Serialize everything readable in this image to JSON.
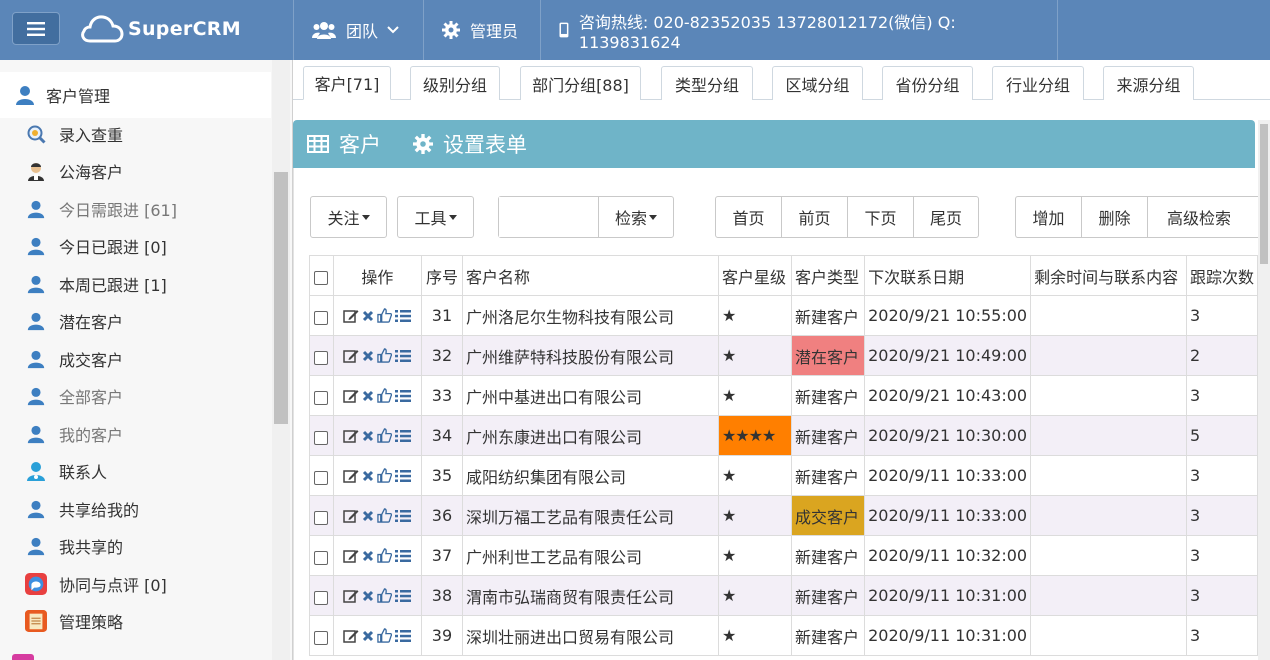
{
  "header": {
    "logo_text": "SuperCRM",
    "team_label": "团队",
    "admin_label": "管理员",
    "hotline": "咨询热线: 020-82352035 13728012172(微信) Q: 1139831624"
  },
  "sidebar": {
    "section_title": "客户管理",
    "items": [
      {
        "label": "录入查重",
        "icon": "search-magnifier-icon"
      },
      {
        "label": "公海客户",
        "icon": "agent-icon"
      },
      {
        "label": "今日需跟进 [61]",
        "icon": "user-icon"
      },
      {
        "label": "今日已跟进 [0]",
        "icon": "user-icon"
      },
      {
        "label": "本周已跟进 [1]",
        "icon": "user-icon"
      },
      {
        "label": "潜在客户",
        "icon": "user-icon"
      },
      {
        "label": "成交客户",
        "icon": "user-icon"
      },
      {
        "label": "全部客户",
        "icon": "user-icon"
      },
      {
        "label": "我的客户",
        "icon": "user-icon"
      },
      {
        "label": "联系人",
        "icon": "contact-icon"
      },
      {
        "label": "共享给我的",
        "icon": "user-icon"
      },
      {
        "label": "我共享的",
        "icon": "user-icon"
      },
      {
        "label": "协同与点评 [0]",
        "icon": "chat-icon"
      },
      {
        "label": "管理策略",
        "icon": "notepad-icon"
      }
    ]
  },
  "tabs": [
    "客户[71]",
    "级别分组",
    "部门分组[88]",
    "类型分组",
    "区域分组",
    "省份分组",
    "行业分组",
    "来源分组"
  ],
  "panel": {
    "title": "客户",
    "settings": "设置表单"
  },
  "toolbar": {
    "follow": "关注",
    "tools": "工具",
    "search_value": "",
    "search_btn": "检索",
    "first": "首页",
    "prev": "前页",
    "next": "下页",
    "last": "尾页",
    "add": "增加",
    "delete": "删除",
    "advanced": "高级检索"
  },
  "table": {
    "columns": [
      "操作",
      "序号",
      "客户名称",
      "客户星级",
      "客户类型",
      "下次联系日期",
      "剩余时间与联系内容",
      "跟踪次数"
    ],
    "rows": [
      {
        "no": "31",
        "name": "广州洛尼尔生物科技有限公司",
        "stars": "★",
        "type": "新建客户",
        "date": "2020/9/21 10:55:00",
        "remain": "",
        "count": "3"
      },
      {
        "no": "32",
        "name": "广州维萨特科技股份有限公司",
        "stars": "★",
        "type": "潜在客户",
        "date": "2020/9/21 10:49:00",
        "remain": "",
        "count": "2"
      },
      {
        "no": "33",
        "name": "广州中基进出口有限公司",
        "stars": "★",
        "type": "新建客户",
        "date": "2020/9/21 10:43:00",
        "remain": "",
        "count": "3"
      },
      {
        "no": "34",
        "name": "广州东康进出口有限公司",
        "stars": "★★★★",
        "type": "新建客户",
        "date": "2020/9/21 10:30:00",
        "remain": "",
        "count": "5"
      },
      {
        "no": "35",
        "name": "咸阳纺织集团有限公司",
        "stars": "★",
        "type": "新建客户",
        "date": "2020/9/11 10:33:00",
        "remain": "",
        "count": "3"
      },
      {
        "no": "36",
        "name": "深圳万福工艺品有限责任公司",
        "stars": "★",
        "type": "成交客户",
        "date": "2020/9/11 10:33:00",
        "remain": "",
        "count": "3"
      },
      {
        "no": "37",
        "name": "广州利世工艺品有限公司",
        "stars": "★",
        "type": "新建客户",
        "date": "2020/9/11 10:32:00",
        "remain": "",
        "count": "3"
      },
      {
        "no": "38",
        "name": "渭南市弘瑞商贸有限责任公司",
        "stars": "★",
        "type": "新建客户",
        "date": "2020/9/11 10:31:00",
        "remain": "",
        "count": "3"
      },
      {
        "no": "39",
        "name": "深圳壮丽进出口贸易有限公司",
        "stars": "★",
        "type": "新建客户",
        "date": "2020/9/11 10:31:00",
        "remain": "",
        "count": "3"
      }
    ]
  },
  "colors": {
    "topbar": "#5b86b8",
    "panel_header": "#6fb4c8",
    "star_highlight": "#ff7f00",
    "potential_customer": "#f08080",
    "deal_customer": "#daa520"
  }
}
